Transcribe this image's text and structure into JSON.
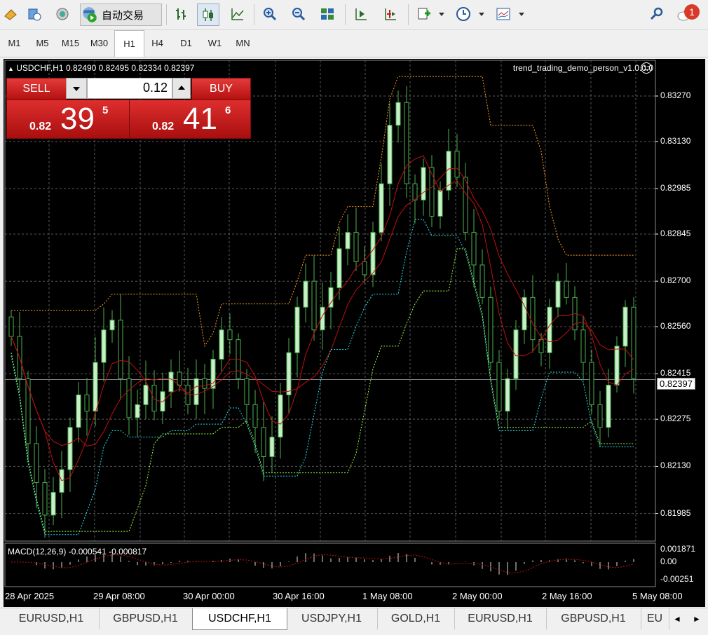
{
  "toolbar": {
    "auto_trading_label": "自动交易",
    "notification_count": "1"
  },
  "timeframes": [
    "M1",
    "M5",
    "M15",
    "M30",
    "H1",
    "H4",
    "D1",
    "W1",
    "MN"
  ],
  "active_timeframe_index": 4,
  "chart": {
    "title": "USDCHF,H1  0.82490 0.82495 0.82334 0.82397",
    "ea_label": "trend_trading_demo_person_v1.0.0.0",
    "current_price": "0.82397",
    "price_labels": [
      "0.83270",
      "0.83130",
      "0.82985",
      "0.82845",
      "0.82700",
      "0.82560",
      "0.82415",
      "0.82275",
      "0.82130",
      "0.81985"
    ],
    "time_labels": [
      "28 Apr 2025",
      "29 Apr 08:00",
      "30 Apr 00:00",
      "30 Apr 16:00",
      "1 May 08:00",
      "2 May 00:00",
      "2 May 16:00",
      "5 May 08:00"
    ],
    "macd_label": "MACD(12,26,9) -0.000541 -0.000817",
    "macd_labels": [
      "0.001871",
      "0.00",
      "-0.00251"
    ],
    "colors": {
      "background": "#000000",
      "candle_up": "#c8f0c8",
      "candle_down": "#000000",
      "candle_wick": "#4caf50",
      "grid": "#5a5a5a",
      "cyan_line": "#22e0f0",
      "orange_line": "#ffa020",
      "lime_line": "#a0ff40",
      "red_line": "#c01010"
    }
  },
  "trade_panel": {
    "sell_label": "SELL",
    "buy_label": "BUY",
    "lot": "0.12",
    "sell_price": {
      "prefix": "0.82",
      "big": "39",
      "sup": "5"
    },
    "buy_price": {
      "prefix": "0.82",
      "big": "41",
      "sup": "6"
    }
  },
  "chart_data": {
    "type": "candlestick",
    "symbol": "USDCHF",
    "timeframe": "H1",
    "title": "USDCHF,H1  0.82490 0.82495 0.82334 0.82397",
    "ylim": [
      0.819,
      0.8338
    ],
    "y_ticks": [
      0.8327,
      0.8313,
      0.82985,
      0.82845,
      0.827,
      0.8256,
      0.82415,
      0.82275,
      0.8213,
      0.81985
    ],
    "x_ticks": [
      "28 Apr 2025",
      "29 Apr 08:00",
      "30 Apr 00:00",
      "30 Apr 16:00",
      "1 May 08:00",
      "2 May 00:00",
      "2 May 16:00",
      "5 May 08:00"
    ],
    "last_ohlc": {
      "open": 0.8249,
      "high": 0.82495,
      "low": 0.82334,
      "close": 0.82397
    },
    "closes_approx": [
      0.8253,
      0.824,
      0.822,
      0.8208,
      0.8198,
      0.8205,
      0.8212,
      0.8225,
      0.8235,
      0.823,
      0.8245,
      0.8255,
      0.8258,
      0.824,
      0.8228,
      0.8232,
      0.8238,
      0.823,
      0.8236,
      0.8242,
      0.8238,
      0.8232,
      0.824,
      0.8237,
      0.8246,
      0.8255,
      0.8252,
      0.824,
      0.8232,
      0.8225,
      0.8216,
      0.8222,
      0.8235,
      0.8248,
      0.8262,
      0.827,
      0.8255,
      0.8262,
      0.8268,
      0.828,
      0.8285,
      0.8276,
      0.8272,
      0.8285,
      0.83,
      0.8318,
      0.8325,
      0.83,
      0.8295,
      0.8305,
      0.829,
      0.8298,
      0.831,
      0.8302,
      0.8285,
      0.8275,
      0.8265,
      0.8245,
      0.823,
      0.824,
      0.8255,
      0.8265,
      0.8252,
      0.8248,
      0.8262,
      0.827,
      0.8265,
      0.8255,
      0.8245,
      0.8232,
      0.8225,
      0.8238,
      0.825,
      0.8262,
      0.824
    ],
    "macd": {
      "label": "MACD(12,26,9)",
      "main": -0.000541,
      "signal": -0.000817,
      "ylim": [
        -0.00251,
        0.001871
      ]
    }
  }
}
